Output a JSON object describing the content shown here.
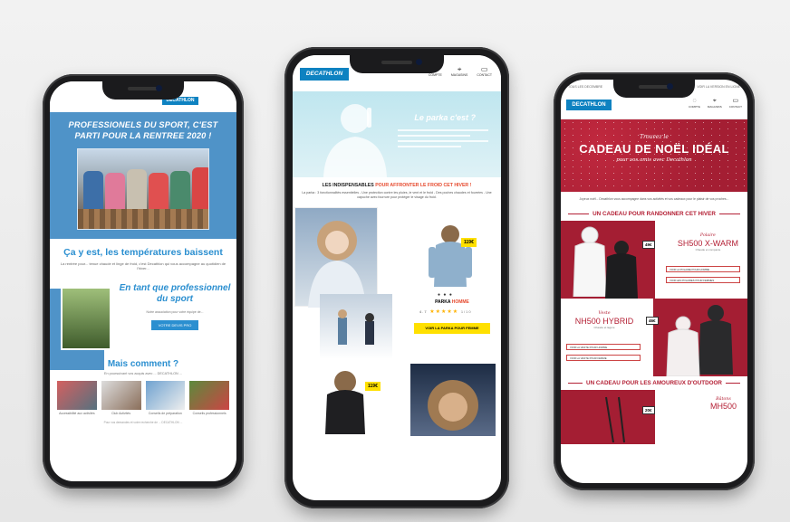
{
  "phone_left": {
    "logo": "DECATHLON",
    "hero_title": "PROFESSIONELS DU SPORT, C'EST PARTI POUR LA RENTREE 2020 !",
    "temp_title": "Ça y est, les températures baissent",
    "temp_text": "La rentrée pour... tenue chaude et linge de froid, c'est Decathlon qui vous accompagne au quotidien de l'hiver...",
    "pro_title": "En tant que professionnel du sport",
    "pro_text": "Notre association pour votre équipe de...",
    "pro_button": "VOTRE DEVIS PRO",
    "mais_title": "Mais comment ?",
    "mais_text": "En poursuivant vos acquis avec ... DECATHLON ...",
    "thumbs": [
      "Accessibilité aux activités",
      "Club Activités",
      "Conseils de préparation",
      "Conseils professionnels"
    ],
    "footer": "Pour vos demandes et votre recherche de ... DECATHLON ..."
  },
  "phone_middle": {
    "logo": "DECATHLON",
    "nav": [
      {
        "icon": "user-icon",
        "glyph": "◌",
        "label": "COMPTE"
      },
      {
        "icon": "location-icon",
        "glyph": "⌖",
        "label": "MAGASINS"
      },
      {
        "icon": "chat-icon",
        "glyph": "▭",
        "label": "CONTACT"
      }
    ],
    "hero_question": "Le parka c'est ?",
    "heading_black": "LES INDISPENSABLES",
    "heading_red": "POUR AFFRONTER LE FROID CET HIVER !",
    "sub_text": "La parka : 3 fonctionnalités essentielles - Une protection contre les pluies, le vent et le froid - Des poches chaudes et fourrées - Une capuche avec fourrure pour protéger le visage du froid.",
    "product_price": "119€",
    "product_name_black": "PARKA",
    "product_name_red": "HOMME",
    "rating_value": "4.7",
    "stars": "★★★★★",
    "reviews": "1/10",
    "cta": "VOIR LA PARKA POUR FEMME",
    "second_price": "119€"
  },
  "phone_right": {
    "status_left": "TOUS LES DECEMBRE",
    "status_right": "VOIR LA VERSION EN LIGNE",
    "logo": "DECATHLON",
    "nav": [
      {
        "icon": "user-icon",
        "glyph": "◌",
        "label": "COMPTE"
      },
      {
        "icon": "location-icon",
        "glyph": "⌖",
        "label": "MAGASINS"
      },
      {
        "icon": "chat-icon",
        "glyph": "▭",
        "label": "CONTACT"
      }
    ],
    "hero_top": "Trouvez le",
    "hero_title": "CADEAU DE NOËL IDÉAL",
    "hero_bottom": "pour vos amis avec Decathlon",
    "intro": "Joyeux noël... Decathlon vous accompagne dans vos activités et vos cadeaux pour le plaisir de vos proches...",
    "section1": "UN CADEAU POUR RANDONNER CET HIVER",
    "product1_tag": "49€",
    "product1_small": "Polaire",
    "product1_name": "SH500 X-WARM",
    "product1_desc": "Chaude et compacte",
    "product1_buttons": [
      "VOIR LA POLAIRE POUR HOMME",
      "VOIR LES POLAIRES POUR FEMMES"
    ],
    "product2_tag": "46€",
    "product2_small": "Veste",
    "product2_name": "NH500 HYBRID",
    "product2_desc": "Chaude et légère",
    "product2_buttons": [
      "VOIR LA VESTE POUR HOMME",
      "VOIR LA VESTE POUR FEMME"
    ],
    "section2": "UN CADEAU POUR LES AMOUREUX D'OUTDOOR",
    "product3_tag": "20€",
    "product3_small": "Bâtons",
    "product3_name": "MH500"
  },
  "colors": {
    "decathlon_blue": "#0e82c1",
    "hero_blue": "#4f93c8",
    "christmas_red": "#a41e33",
    "cta_yellow": "#ffe000"
  }
}
